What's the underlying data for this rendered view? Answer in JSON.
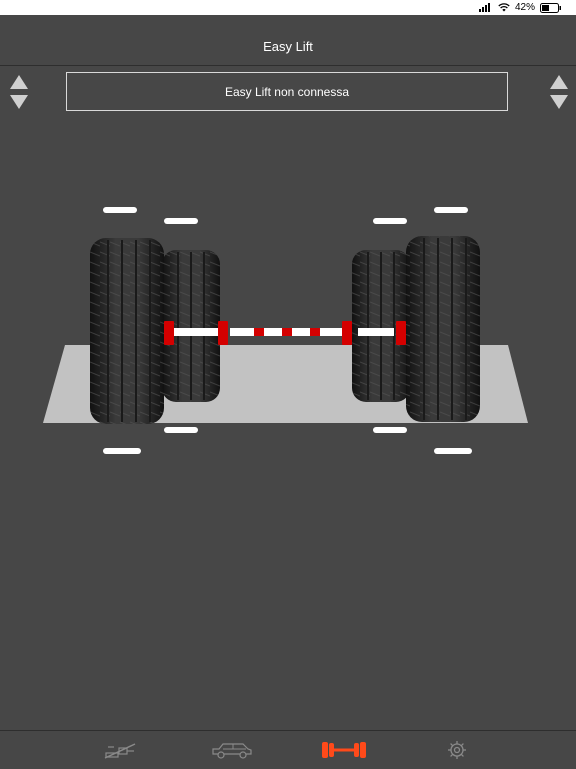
{
  "status_bar": {
    "battery_percent": "42%",
    "signal_bars": 4,
    "wifi": true
  },
  "header": {
    "title": "Easy Lift"
  },
  "connection_status": "Easy Lift non connessa",
  "colors": {
    "background": "#474747",
    "accent": "#ff4a1a",
    "indicator_red": "#d40000",
    "ground": "#c2c2c2",
    "tire": "#222222"
  },
  "controls": {
    "left_arrows": [
      "arrow-up-icon",
      "arrow-down-icon"
    ],
    "right_arrows": [
      "arrow-up-icon",
      "arrow-down-icon"
    ]
  },
  "tabs": [
    {
      "name": "tab-jack",
      "icon": "jack-icon",
      "active": false
    },
    {
      "name": "tab-vehicle",
      "icon": "suv-icon",
      "active": false
    },
    {
      "name": "tab-axle",
      "icon": "axle-icon",
      "active": true
    },
    {
      "name": "tab-settings",
      "icon": "gear-icon",
      "active": false
    }
  ]
}
